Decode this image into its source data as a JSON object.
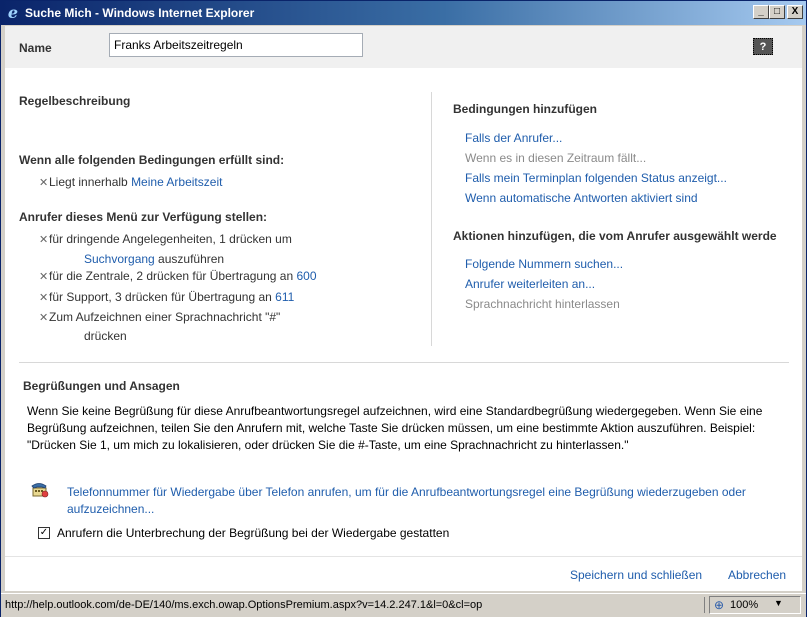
{
  "window": {
    "title": "Suche Mich - Windows Internet Explorer",
    "minimize": "_",
    "maximize": "□",
    "close": "X"
  },
  "name_row": {
    "label": "Name",
    "value": "Franks Arbeitszeitregeln",
    "help": "?"
  },
  "left": {
    "heading": "Regelbeschreibung",
    "conditions_heading": "Wenn alle folgenden Bedingungen erfüllt sind:",
    "condition": {
      "prefix": "Liegt innerhalb ",
      "link": "Meine Arbeitszeit"
    },
    "menu_heading": "Anrufer dieses Menü zur Verfügung stellen:",
    "menu_items": [
      {
        "line1": "für dringende Angelegenheiten, 1 drücken um",
        "link": "Suchvorgang",
        "suffix": " auszuführen"
      },
      {
        "text": "für die Zentrale, 2 drücken für Übertragung an ",
        "link": "600"
      },
      {
        "text": "für Support, 3 drücken für Übertragung an ",
        "link": "611"
      },
      {
        "line1": "Zum Aufzeichnen einer Sprachnachricht \"#\"",
        "line2": "drücken"
      }
    ]
  },
  "right": {
    "conditions_heading": "Bedingungen hinzufügen",
    "conditions": [
      {
        "label": "Falls der Anrufer...",
        "enabled": true
      },
      {
        "label": "Wenn es in diesen Zeitraum fällt...",
        "enabled": false
      },
      {
        "label": "Falls mein Terminplan folgenden Status anzeigt...",
        "enabled": true
      },
      {
        "label": "Wenn automatische Antworten aktiviert sind",
        "enabled": true
      }
    ],
    "actions_heading": "Aktionen hinzufügen, die vom Anrufer ausgewählt werde",
    "actions": [
      {
        "label": "Folgende Nummern suchen...",
        "enabled": true
      },
      {
        "label": "Anrufer weiterleiten an...",
        "enabled": true
      },
      {
        "label": "Sprachnachricht hinterlassen",
        "enabled": false
      }
    ]
  },
  "greetings": {
    "heading": "Begrüßungen und Ansagen",
    "paragraph": "Wenn Sie keine Begrüßung für diese Anrufbeantwortungsregel aufzeichnen, wird eine Standardbegrüßung wiedergegeben. Wenn Sie eine Begrüßung aufzeichnen, teilen Sie den Anrufern mit, welche Taste Sie drücken müssen, um eine bestimmte Aktion auszuführen. Beispiel: \"Drücken Sie 1, um mich zu lokalisieren, oder drücken Sie die #-Taste, um eine Sprachnachricht zu hinterlassen.\"",
    "phone_link": "Telefonnummer für Wiedergabe über Telefon anrufen, um für die Anrufbeantwortungsregel eine Begrüßung wiederzugeben oder aufzuzeichnen...",
    "checkbox_label": "Anrufern die Unterbrechung der Begrüßung bei der Wiedergabe gestatten",
    "checkbox_checked": true
  },
  "footer": {
    "save": "Speichern und schließen",
    "cancel": "Abbrechen"
  },
  "statusbar": {
    "url": "http://help.outlook.com/de-DE/140/ms.exch.owap.OptionsPremium.aspx?v=14.2.247.1&l=0&cl=op",
    "zoom": "100%"
  },
  "colors": {
    "link": "#1f5dac",
    "disabled": "#8a8a8a",
    "titlebar": "#0a246a"
  }
}
